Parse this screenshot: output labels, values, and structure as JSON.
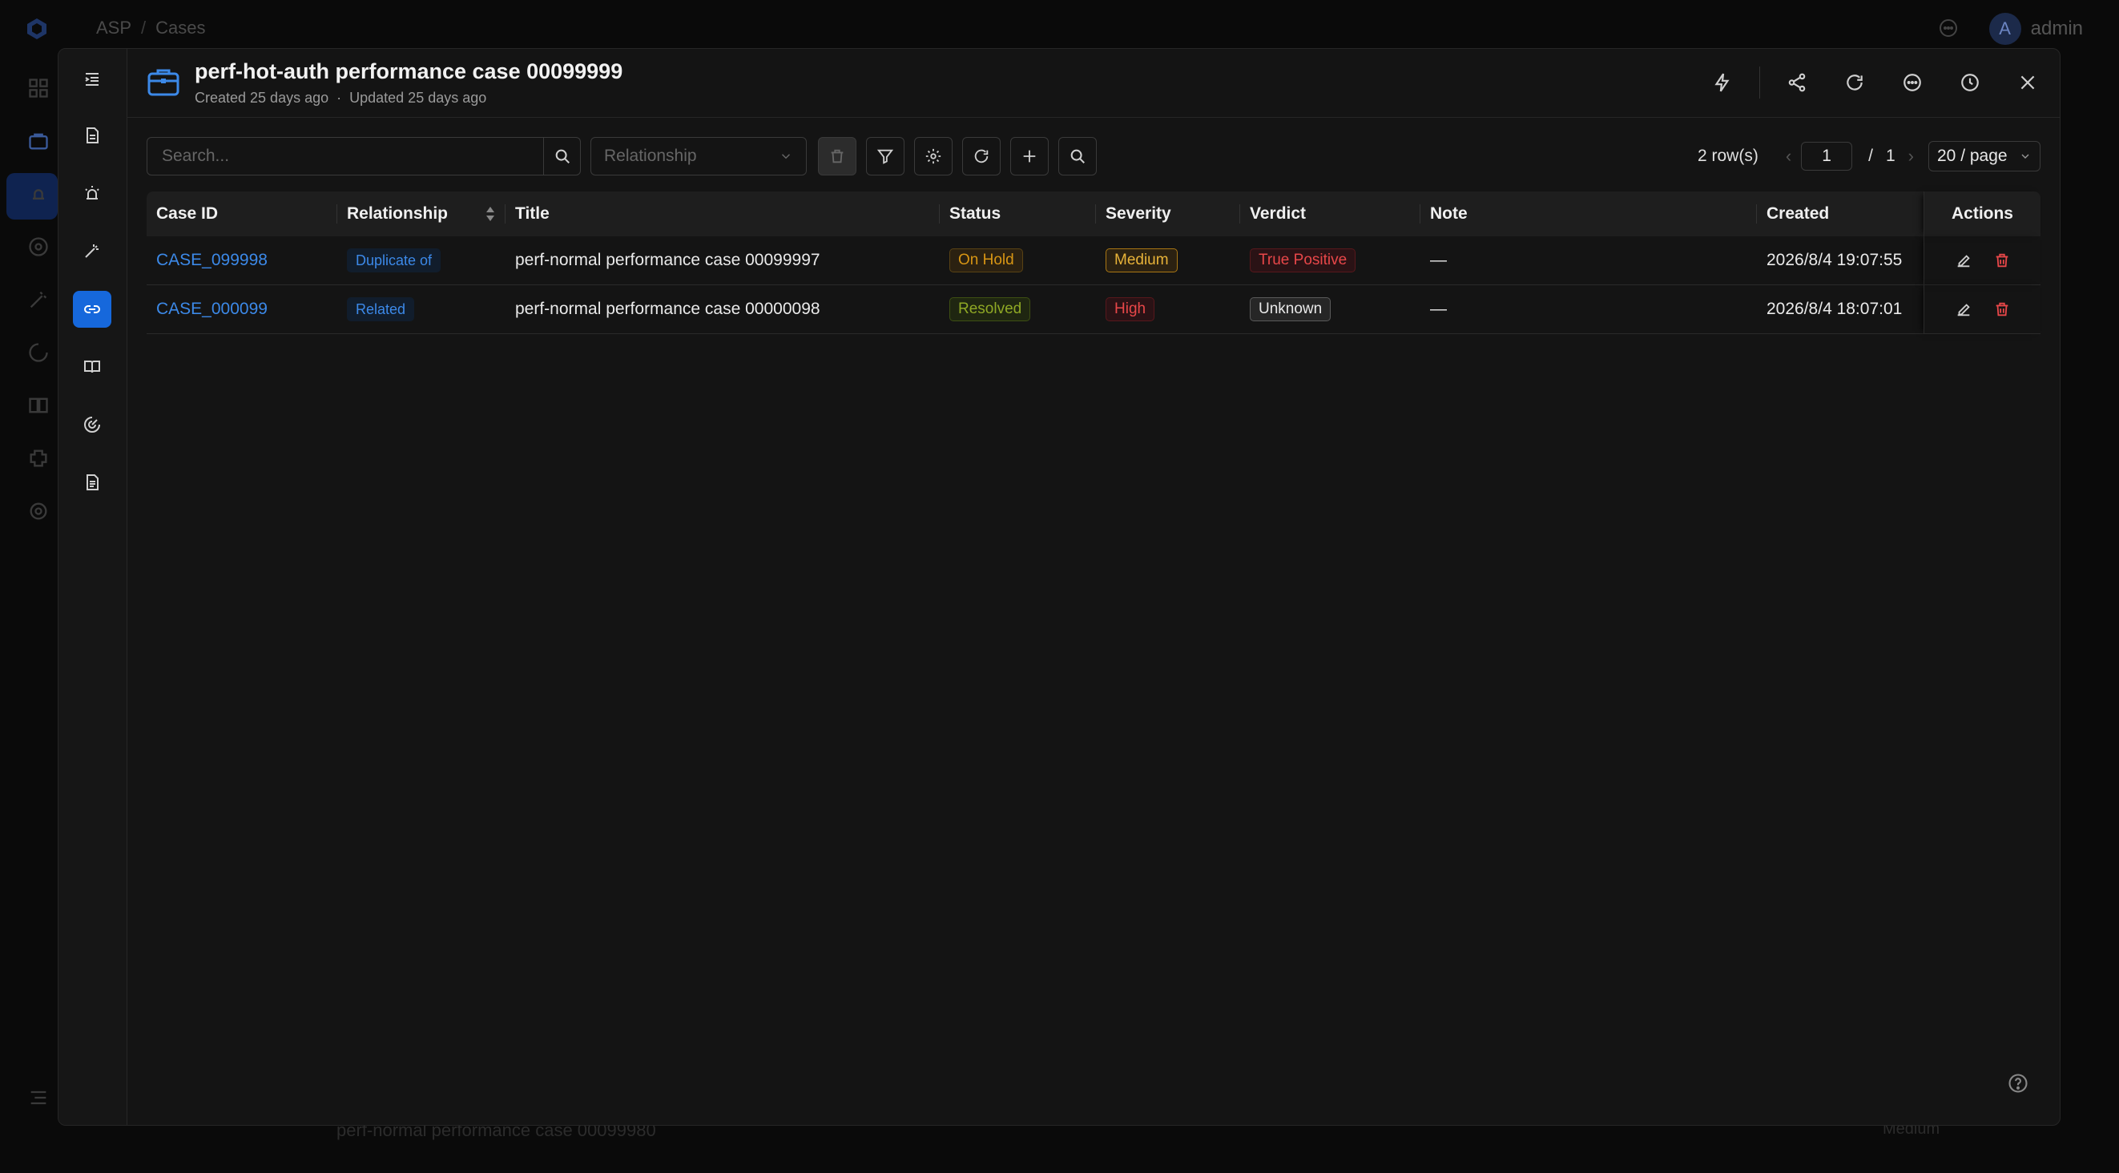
{
  "background": {
    "breadcrumb": [
      "ASP",
      "Cases"
    ],
    "user": {
      "avatar_letter": "A",
      "name": "admin"
    },
    "bottom_row_title": "perf-normal performance case 00099980",
    "bottom_row_right": "Medium"
  },
  "modal": {
    "title": "perf-hot-auth performance case 00099999",
    "created": "Created 25 days ago",
    "updated": "Updated 25 days ago",
    "rail": [
      {
        "name": "menu-toggle-icon"
      },
      {
        "name": "document-icon"
      },
      {
        "name": "alarm-icon"
      },
      {
        "name": "magic-wand-icon"
      },
      {
        "name": "link-icon",
        "active": true
      },
      {
        "name": "book-icon"
      },
      {
        "name": "radar-icon"
      },
      {
        "name": "file-text-icon"
      }
    ],
    "header_actions": [
      "lightning-icon",
      "share-icon",
      "refresh-icon",
      "comment-icon",
      "history-icon",
      "close-icon"
    ]
  },
  "toolbar": {
    "search_placeholder": "Search...",
    "relationship_placeholder": "Relationship"
  },
  "pager": {
    "rows": "2 row(s)",
    "current_page": "1",
    "total_pages": "1",
    "page_size": "20 / page"
  },
  "table": {
    "columns": [
      "Case ID",
      "Relationship",
      "Title",
      "Status",
      "Severity",
      "Verdict",
      "Note",
      "Created",
      "Actions"
    ],
    "rows": [
      {
        "case_id": "CASE_099998",
        "relationship": "Duplicate of",
        "title": "perf-normal performance case 00099997",
        "status": "On Hold",
        "severity": "Medium",
        "verdict": "True Positive",
        "note": "—",
        "created": "2026/8/4 19:07:55"
      },
      {
        "case_id": "CASE_000099",
        "relationship": "Related",
        "title": "perf-normal performance case 00000098",
        "status": "Resolved",
        "severity": "High",
        "verdict": "Unknown",
        "note": "—",
        "created": "2026/8/4 18:07:01"
      }
    ]
  },
  "colors": {
    "accent": "#1668dc",
    "link": "#3c89e8",
    "danger": "#e84749"
  }
}
